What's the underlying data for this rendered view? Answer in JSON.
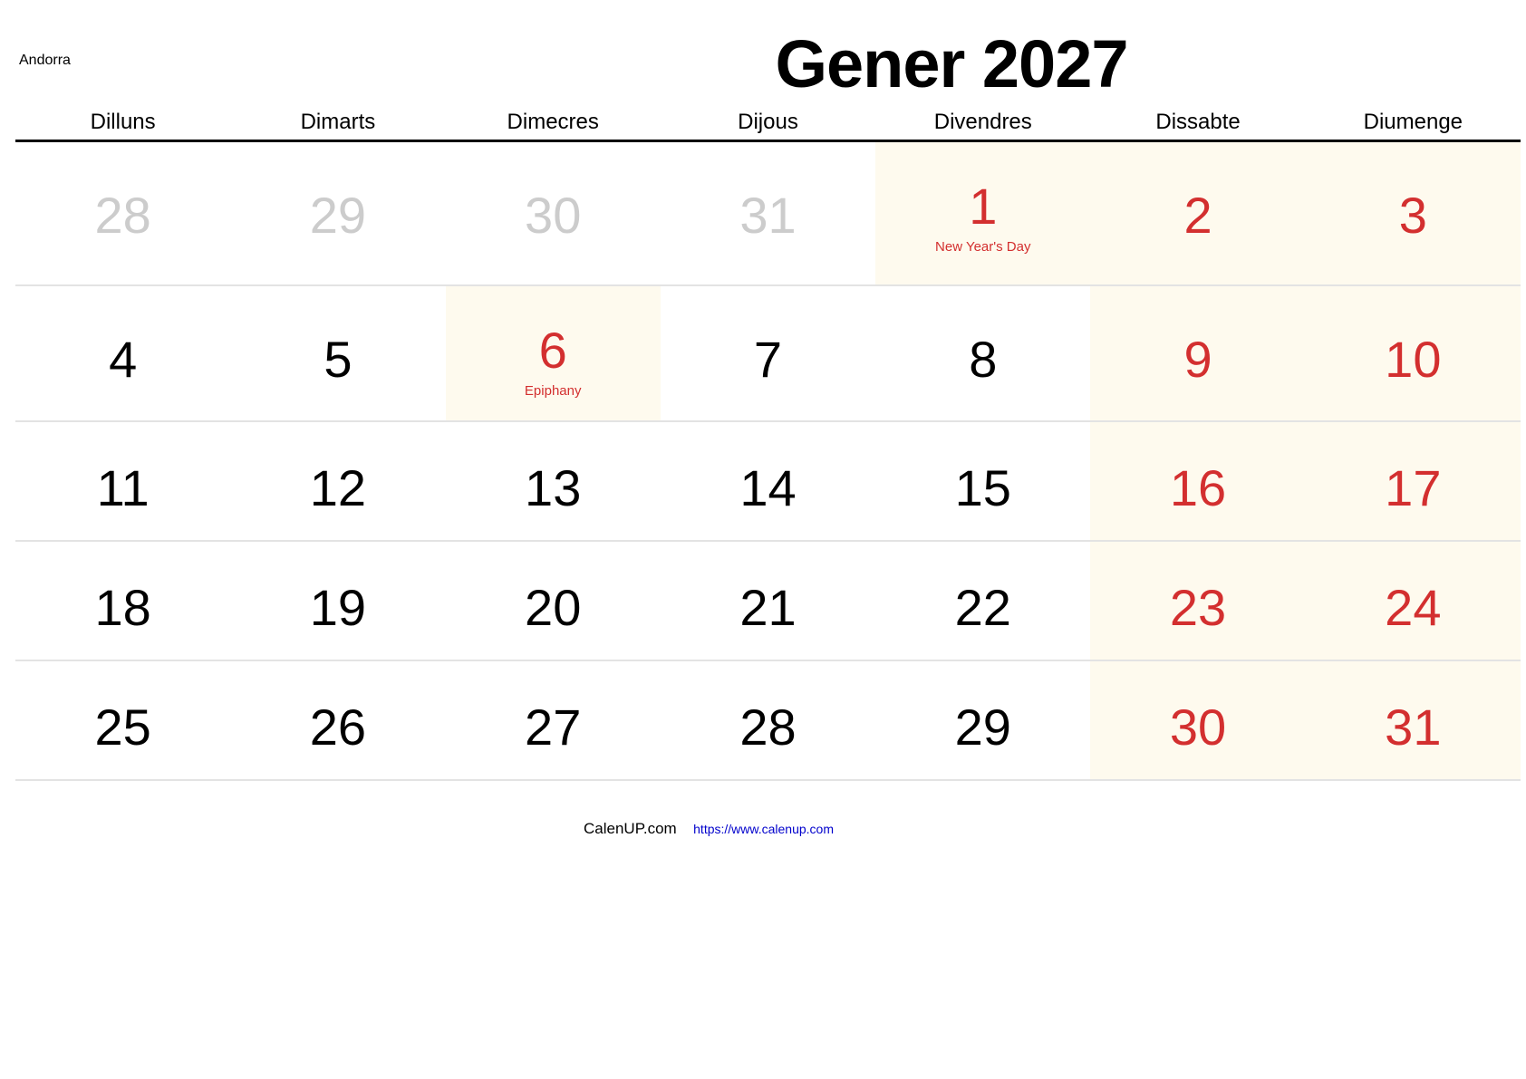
{
  "region": "Andorra",
  "title": "Gener 2027",
  "weekdays": [
    "Dilluns",
    "Dimarts",
    "Dimecres",
    "Dijous",
    "Divendres",
    "Dissabte",
    "Diumenge"
  ],
  "colors": {
    "holiday_red": "#d32f2f",
    "other_month_gray": "#cccccc",
    "weekend_bg": "#fefaee",
    "link_blue": "#0000cc"
  },
  "weeks": [
    [
      {
        "day": "28",
        "type": "other"
      },
      {
        "day": "29",
        "type": "other"
      },
      {
        "day": "30",
        "type": "other"
      },
      {
        "day": "31",
        "type": "other"
      },
      {
        "day": "1",
        "type": "holiday",
        "holiday": "New Year's Day"
      },
      {
        "day": "2",
        "type": "weekend"
      },
      {
        "day": "3",
        "type": "weekend"
      }
    ],
    [
      {
        "day": "4",
        "type": "normal"
      },
      {
        "day": "5",
        "type": "normal"
      },
      {
        "day": "6",
        "type": "holiday",
        "holiday": "Epiphany"
      },
      {
        "day": "7",
        "type": "normal"
      },
      {
        "day": "8",
        "type": "normal"
      },
      {
        "day": "9",
        "type": "weekend"
      },
      {
        "day": "10",
        "type": "weekend"
      }
    ],
    [
      {
        "day": "11",
        "type": "normal"
      },
      {
        "day": "12",
        "type": "normal"
      },
      {
        "day": "13",
        "type": "normal"
      },
      {
        "day": "14",
        "type": "normal"
      },
      {
        "day": "15",
        "type": "normal"
      },
      {
        "day": "16",
        "type": "weekend"
      },
      {
        "day": "17",
        "type": "weekend"
      }
    ],
    [
      {
        "day": "18",
        "type": "normal"
      },
      {
        "day": "19",
        "type": "normal"
      },
      {
        "day": "20",
        "type": "normal"
      },
      {
        "day": "21",
        "type": "normal"
      },
      {
        "day": "22",
        "type": "normal"
      },
      {
        "day": "23",
        "type": "weekend"
      },
      {
        "day": "24",
        "type": "weekend"
      }
    ],
    [
      {
        "day": "25",
        "type": "normal"
      },
      {
        "day": "26",
        "type": "normal"
      },
      {
        "day": "27",
        "type": "normal"
      },
      {
        "day": "28",
        "type": "normal"
      },
      {
        "day": "29",
        "type": "normal"
      },
      {
        "day": "30",
        "type": "weekend"
      },
      {
        "day": "31",
        "type": "weekend"
      }
    ]
  ],
  "footer": {
    "brand": "CalenUP.com",
    "link": "https://www.calenup.com"
  }
}
